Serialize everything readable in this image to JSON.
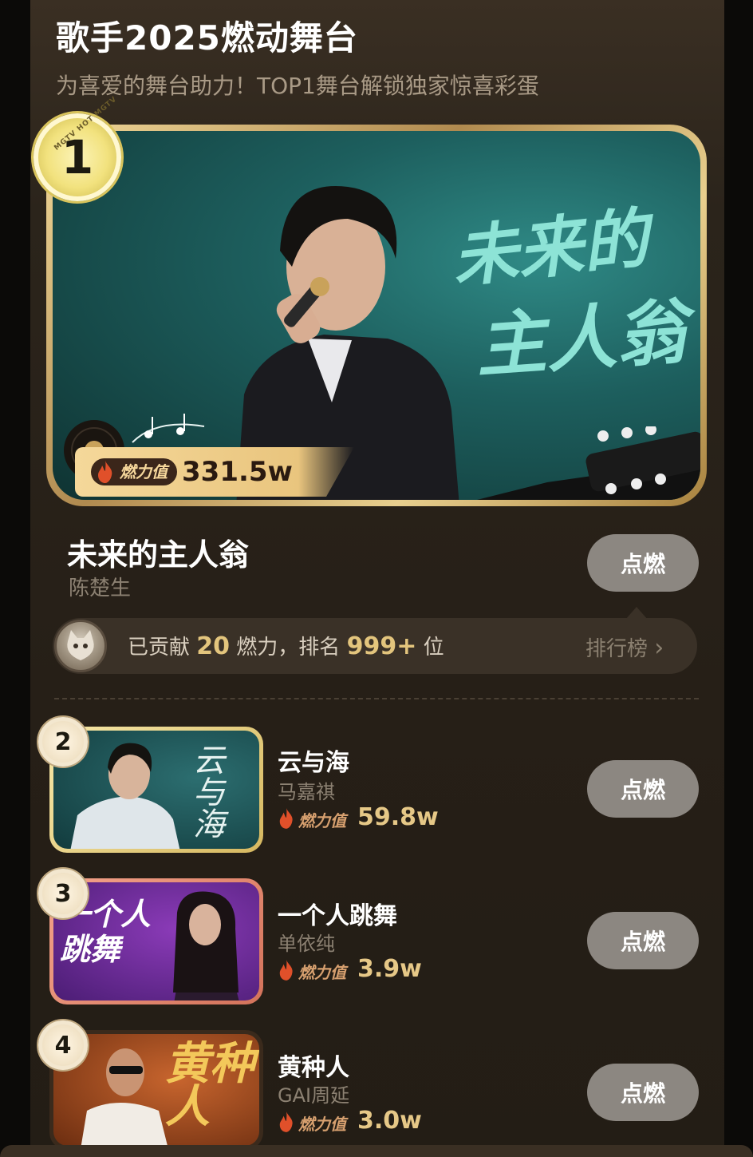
{
  "header": {
    "title": "歌手2025燃动舞台",
    "subtitle": "为喜爱的舞台助力！TOP1舞台解锁独家惊喜彩蛋"
  },
  "featured": {
    "rank": "1",
    "medal_ring_text": "MGTV HOT MGTV",
    "artwork_text_line1": "未来的",
    "artwork_text_line2": "主人翁",
    "burn_label": "燃力值",
    "burn_value": "331.5w",
    "song_title": "未来的主人翁",
    "artist": "陈楚生",
    "ignite_label": "点燃"
  },
  "contribution": {
    "prefix": "已贡献",
    "amount": "20",
    "middle": "燃力，排名",
    "rank": "999+",
    "suffix": "位",
    "leaderboard_label": "排行榜",
    "leaderboard_chevron": "›"
  },
  "items": [
    {
      "rank": "2",
      "song_title": "云与海",
      "artist": "马嘉祺",
      "burn_label": "燃力值",
      "burn_value": "59.8w",
      "artwork_text": "云与海",
      "ignite_label": "点燃"
    },
    {
      "rank": "3",
      "song_title": "一个人跳舞",
      "artist": "单依纯",
      "burn_label": "燃力值",
      "burn_value": "3.9w",
      "artwork_text": "一个人跳舞",
      "ignite_label": "点燃"
    },
    {
      "rank": "4",
      "song_title": "黄种人",
      "artist": "GAI周延",
      "burn_label": "燃力值",
      "burn_value": "3.0w",
      "artwork_text": "黄种人",
      "ignite_label": "点燃"
    }
  ],
  "colors": {
    "accent_gold": "#e3c57d",
    "button_gray": "#8c8781",
    "background": "#2b241b",
    "flame": "#e0502a"
  }
}
